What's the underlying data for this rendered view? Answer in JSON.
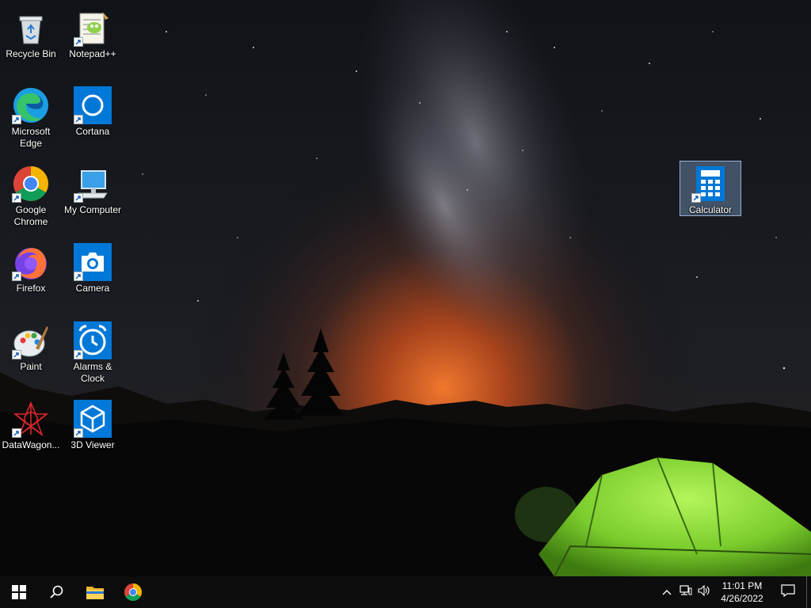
{
  "desktop": {
    "icons": [
      {
        "label": "Recycle Bin",
        "icon": "recycle-bin-icon"
      },
      {
        "label": "Notepad++",
        "icon": "notepad-plus-plus-icon"
      },
      {
        "label": "Microsoft Edge",
        "icon": "edge-icon"
      },
      {
        "label": "Cortana",
        "icon": "cortana-icon"
      },
      {
        "label": "Google Chrome",
        "icon": "chrome-icon"
      },
      {
        "label": "My Computer",
        "icon": "computer-icon"
      },
      {
        "label": "Firefox",
        "icon": "firefox-icon"
      },
      {
        "label": "Camera",
        "icon": "camera-icon"
      },
      {
        "label": "Paint",
        "icon": "paint-icon"
      },
      {
        "label": "Alarms & Clock",
        "icon": "alarm-clock-icon"
      },
      {
        "label": "DataWagon...",
        "icon": "datawagon-icon"
      },
      {
        "label": "3D Viewer",
        "icon": "3d-viewer-icon"
      },
      {
        "label": "Calculator",
        "icon": "calculator-icon",
        "selected": true
      }
    ]
  },
  "taskbar": {
    "start": "windows-start-icon",
    "search": "search-icon",
    "pinned": [
      "file-explorer-icon",
      "chrome-icon"
    ],
    "tray": {
      "icons": [
        "chevron-up-icon",
        "network-icon",
        "volume-icon"
      ],
      "time": "11:01 PM",
      "date": "4/26/2022",
      "notifications": "action-center-icon"
    }
  },
  "colors": {
    "taskbar": "#0d0d0d",
    "selection": "#7896be",
    "windows_blue": "#0078d7",
    "tent_green": "#8ee03a",
    "horizon_orange": "#e8622a"
  }
}
